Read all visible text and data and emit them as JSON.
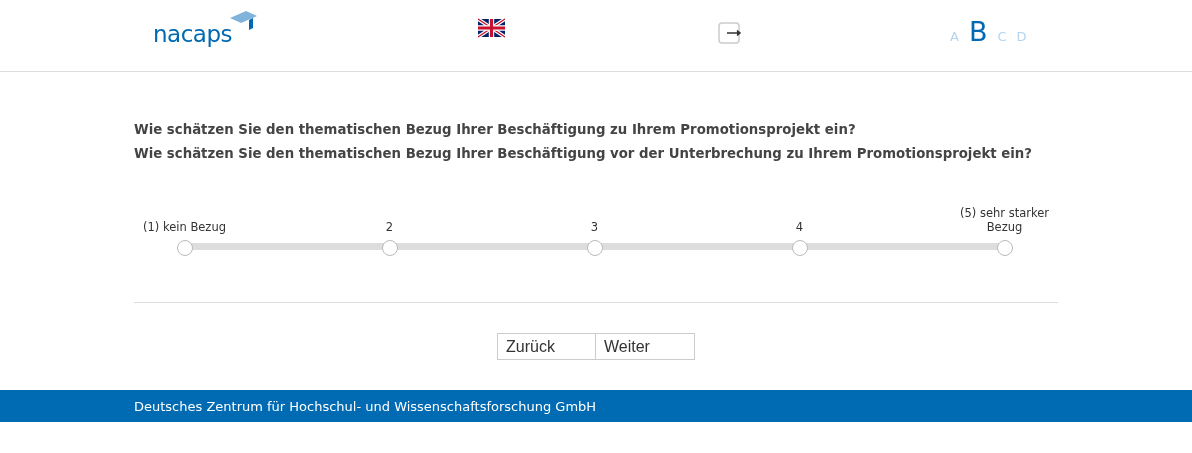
{
  "header": {
    "logo": "nacaps",
    "font_sizes": [
      {
        "label": "A",
        "selected": false
      },
      {
        "label": "B",
        "selected": true
      },
      {
        "label": "C",
        "selected": false
      },
      {
        "label": "D",
        "selected": false
      }
    ]
  },
  "questions": [
    "Wie schätzen Sie den thematischen Bezug Ihrer Beschäftigung zu Ihrem Promotionsprojekt ein?",
    "Wie schätzen Sie den thematischen Bezug Ihrer Beschäftigung vor der Unterbrechung zu Ihrem Promotionsprojekt ein?"
  ],
  "scale": [
    {
      "label": "(1) kein Bezug",
      "selected": false
    },
    {
      "label": "2",
      "selected": false
    },
    {
      "label": "3",
      "selected": false
    },
    {
      "label": "4",
      "selected": false
    },
    {
      "label": "(5) sehr starker Bezug",
      "selected": false
    }
  ],
  "buttons": [
    "Zurück",
    "Weiter"
  ],
  "footer": "Deutsches Zentrum für Hochschul- und Wissenschaftsforschung GmbH"
}
